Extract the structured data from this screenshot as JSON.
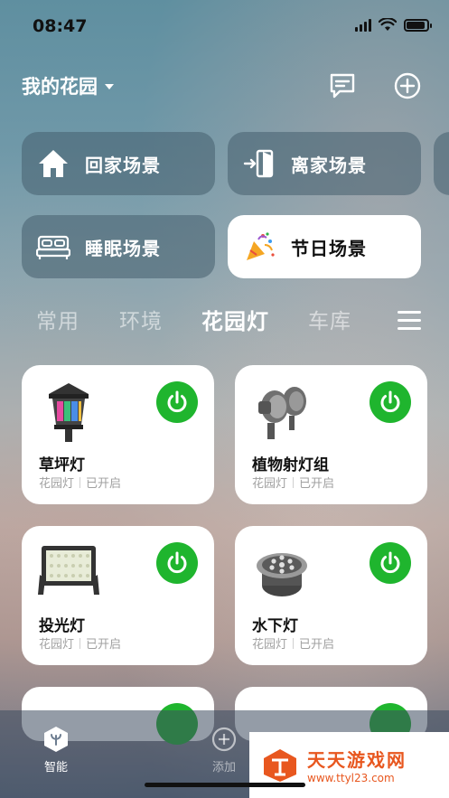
{
  "status_bar": {
    "time": "08:47"
  },
  "header": {
    "home_name": "我的花园"
  },
  "scenes": [
    {
      "label": "回家场景",
      "icon": "house-icon"
    },
    {
      "label": "离家场景",
      "icon": "door-exit-icon"
    },
    {
      "label": "睡眠场景",
      "icon": "bed-icon"
    },
    {
      "label": "节日场景",
      "icon": "party-popper-icon",
      "active": true
    }
  ],
  "tabs": [
    {
      "label": "常用"
    },
    {
      "label": "环境"
    },
    {
      "label": "花园灯",
      "active": true
    },
    {
      "label": "车库"
    }
  ],
  "devices": [
    {
      "name": "草坪灯",
      "room": "花园灯",
      "state": "已开启",
      "icon": "lawn-lamp-icon"
    },
    {
      "name": "植物射灯组",
      "room": "花园灯",
      "state": "已开启",
      "icon": "spotlight-icon"
    },
    {
      "name": "投光灯",
      "room": "花园灯",
      "state": "已开启",
      "icon": "floodlight-icon"
    },
    {
      "name": "水下灯",
      "room": "花园灯",
      "state": "已开启",
      "icon": "underwater-light-icon"
    }
  ],
  "colors": {
    "power_on": "#1fb52e",
    "accent_watermark": "#e8571f"
  },
  "bottom_nav": [
    {
      "label": "智能",
      "icon": "smart-home-icon",
      "active": true
    },
    {
      "label": "添加",
      "icon": "plus-circle-icon"
    }
  ],
  "watermark": {
    "title": "天天游戏网",
    "url": "www.ttyl23.com"
  }
}
